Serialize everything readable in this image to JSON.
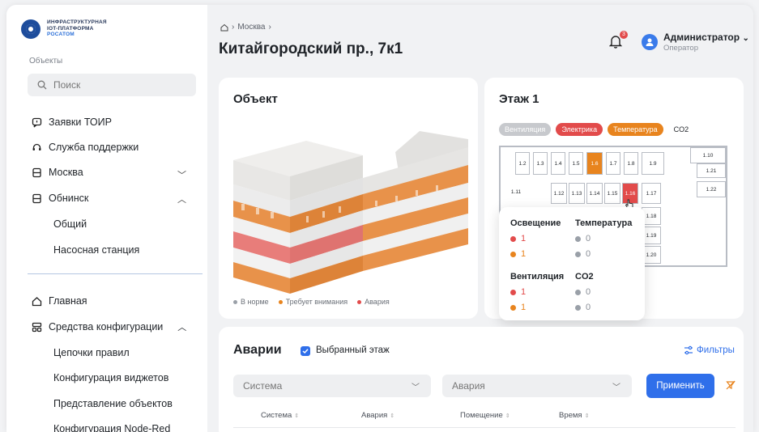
{
  "logo": {
    "line1": "ИНФРАСТРУКТУРНАЯ",
    "line2": "IOT-ПЛАТФОРМА",
    "line3": "РОСАТОМ"
  },
  "sidebar": {
    "objects_label": "Объекты",
    "search_placeholder": "Поиск",
    "items": [
      {
        "label": "Заявки ТОИР"
      },
      {
        "label": "Служба поддержки"
      },
      {
        "label": "Москва"
      },
      {
        "label": "Обнинск"
      }
    ],
    "obninsk_sub": [
      "Общий",
      "Насосная станция"
    ],
    "main_items": [
      {
        "label": "Главная"
      },
      {
        "label": "Средства конфигурации"
      }
    ],
    "config_sub": [
      "Цепочки правил",
      "Конфигурация виджетов",
      "Представление объектов",
      "Конфигурация Node-Red"
    ]
  },
  "header": {
    "breadcrumb": "Москва",
    "title": "Китайгородский пр., 7к1",
    "notifications": "3",
    "user_name": "Администратор",
    "user_role": "Оператор"
  },
  "object_card": {
    "title": "Объект",
    "legend": [
      "В норме",
      "Требует внимания",
      "Авария"
    ]
  },
  "floor_card": {
    "title": "Этаж 1",
    "chips": [
      "Вентиляция",
      "Электрика",
      "Температура",
      "CO2"
    ],
    "rooms": [
      "1.2",
      "1.3",
      "1.4",
      "1.5",
      "1.6",
      "1.7",
      "1.8",
      "1.9",
      "1.10",
      "1.21",
      "1.11",
      "1.12",
      "1.13",
      "1.14",
      "1.15",
      "1.16",
      "1.17",
      "1.22",
      "1.18",
      "1.19",
      "1.20"
    ]
  },
  "tooltip": {
    "lighting": "Освещение",
    "temperature": "Температура",
    "ventilation": "Вентиляция",
    "co2": "CO2",
    "l_red": "1",
    "l_orange": "1",
    "t_grey1": "0",
    "t_grey2": "0",
    "v_red": "1",
    "v_orange": "1",
    "c_grey1": "0",
    "c_grey2": "0"
  },
  "alarms": {
    "title": "Аварии",
    "selected_floor": "Выбранный этаж",
    "filters": "Фильтры",
    "system_select": "Система",
    "alarm_select": "Авария",
    "apply": "Применить",
    "columns": [
      "Система",
      "Авария",
      "Помещение",
      "Время"
    ]
  },
  "colors": {
    "accent": "#2f6fea",
    "orange": "#e8841e",
    "red": "#e24b4b",
    "grey": "#c7c9cd"
  }
}
